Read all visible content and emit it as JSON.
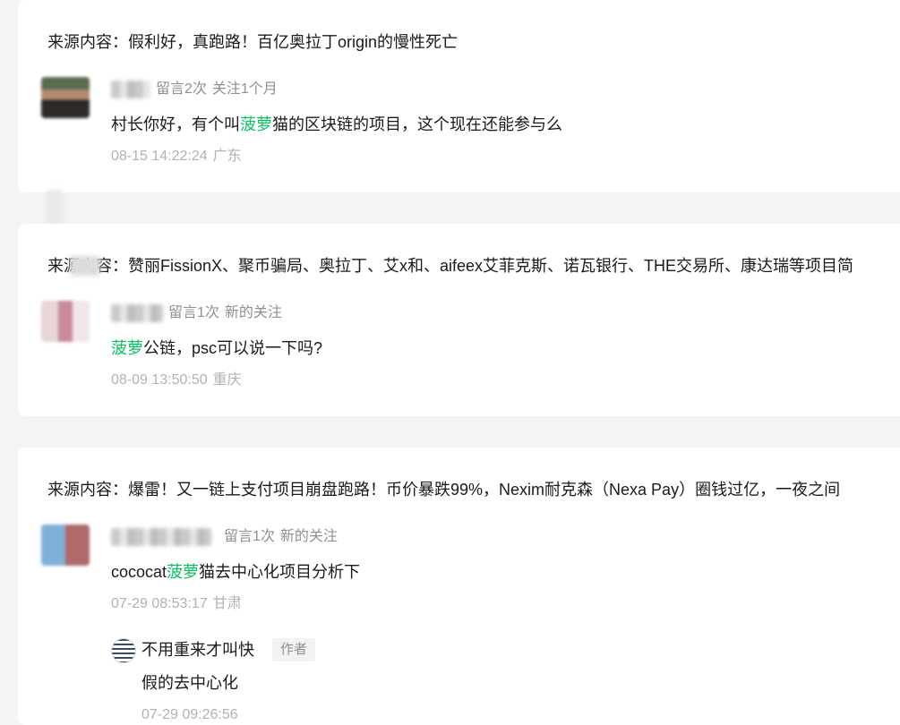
{
  "comments": [
    {
      "source_prefix": "来源内容：",
      "source_title": "假利好，真跑路！百亿奥拉丁origin的慢性死亡",
      "username": "",
      "stats": {
        "messages": "留言2次",
        "follow": "关注1个月"
      },
      "content": {
        "before": "村长你好，有个叫",
        "highlight": "菠萝",
        "after": "猫的区块链的项目，这个现在还能参与么"
      },
      "date": "08-15 14:22:24",
      "location": "广东"
    },
    {
      "source_prefix": "来源内容：",
      "source_title": "赞丽FissionX、聚币骗局、奥拉丁、艾x和、aifeex艾菲克斯、诺瓦银行、THE交易所、康达瑞等项目简",
      "username": "",
      "stats": {
        "messages": "留言1次",
        "follow": "新的关注"
      },
      "content": {
        "before": "",
        "highlight": "菠萝",
        "after": "公链，psc可以说一下吗?"
      },
      "date": "08-09 13:50:50",
      "location": "重庆"
    },
    {
      "source_prefix": "来源内容：",
      "source_title": "爆雷！又一链上支付项目崩盘跑路！币价暴跌99%，Nexim耐克森（Nexa Pay）圈钱过亿，一夜之间",
      "username": "",
      "stats": {
        "messages": "留言1次",
        "follow": "新的关注"
      },
      "content": {
        "before": "cococat",
        "highlight": "菠萝",
        "after": "猫去中心化项目分析下"
      },
      "date": "07-29 08:53:17",
      "location": "甘肃",
      "reply": {
        "name": "不用重来才叫快",
        "tag": "作者",
        "content": "假的去中心化",
        "date": "07-29 09:26:56",
        "location": ""
      }
    }
  ],
  "colors": {
    "highlight": "#07c160",
    "meta": "#8f8f8f",
    "time": "#b2b2b2",
    "background": "#f4f4f5",
    "card": "#ffffff"
  },
  "icons": {
    "avatar": "user-avatar-image",
    "author_avatar": "author-avatar-image"
  }
}
